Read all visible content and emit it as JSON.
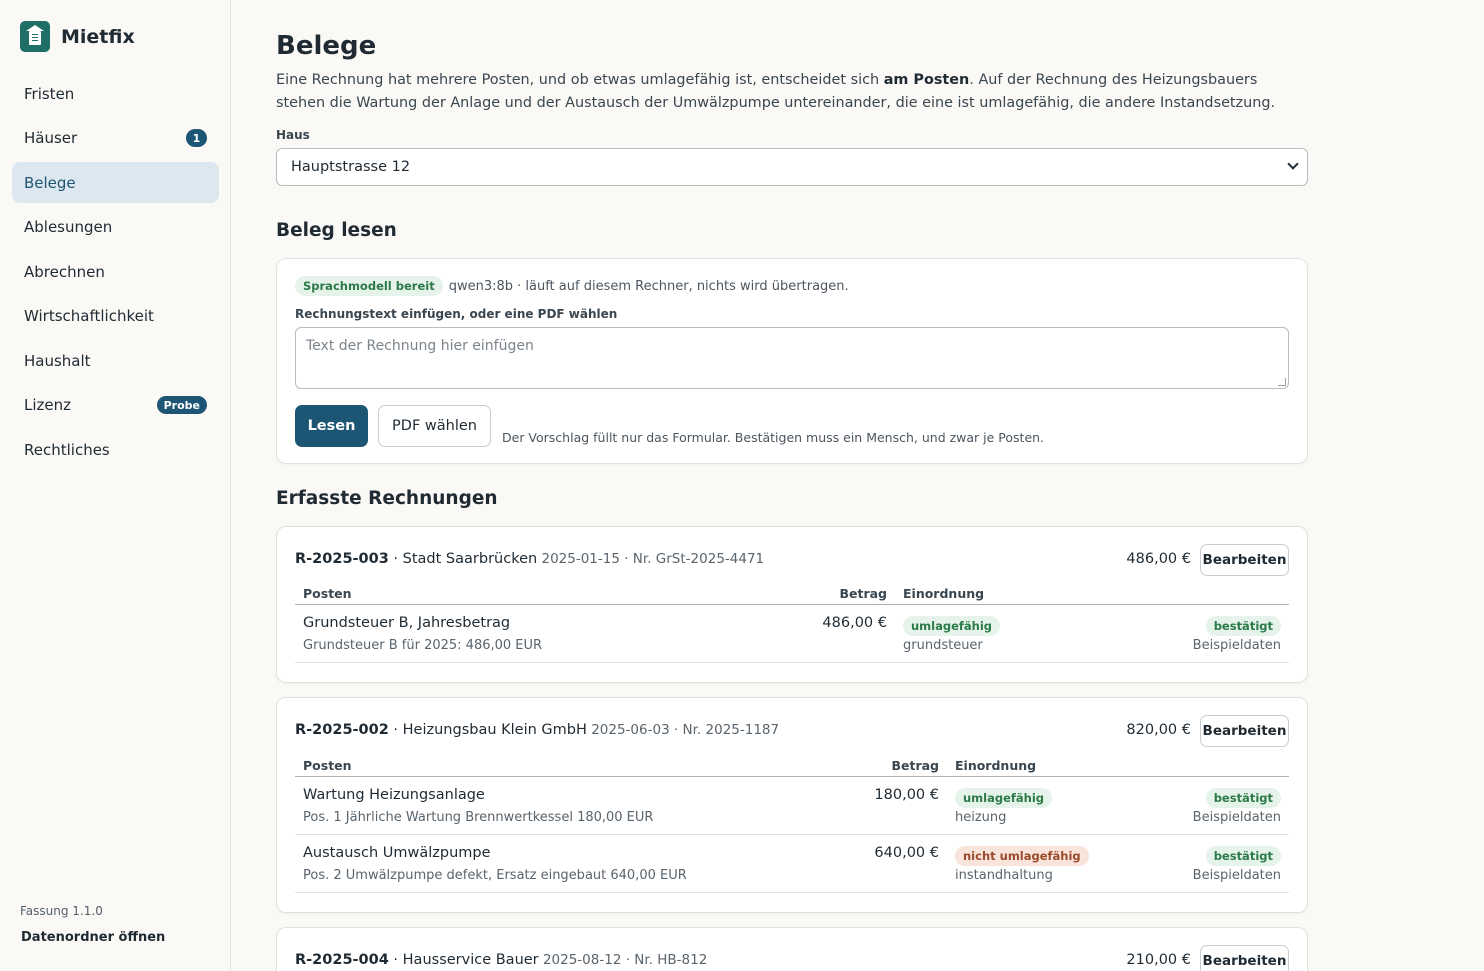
{
  "app": {
    "name": "Mietfix",
    "version": "Fassung 1.1.0",
    "open_folder": "Datenordner öffnen",
    "brand_color": "#1f6f66",
    "accent": "#1d5674"
  },
  "sidebar": {
    "items": [
      {
        "label": "Fristen"
      },
      {
        "label": "Häuser",
        "badge": "1"
      },
      {
        "label": "Belege",
        "active": true
      },
      {
        "label": "Ablesungen"
      },
      {
        "label": "Abrechnen"
      },
      {
        "label": "Wirtschaftlichkeit"
      },
      {
        "label": "Haushalt"
      },
      {
        "label": "Lizenz",
        "badge": "Probe"
      },
      {
        "label": "Rechtliches"
      }
    ]
  },
  "page": {
    "title": "Belege",
    "intro_1": "Eine Rechnung hat mehrere Posten, und ob etwas umlagefähig ist, entscheidet sich ",
    "intro_bold": "am Posten",
    "intro_2": ". Auf der Rechnung des Heizungsbauers stehen die Wartung der Anlage und der Austausch der Umwälzpumpe untereinander, die eine ist umlagefähig, die andere Instandsetzung.",
    "haus_label": "Haus",
    "haus_value": "Hauptstrasse 12"
  },
  "reader": {
    "heading": "Beleg lesen",
    "model_status": "Sprachmodell bereit",
    "model_info": "qwen3:8b · läuft auf diesem Rechner, nichts wird übertragen.",
    "text_label": "Rechnungstext einfügen, oder eine PDF wählen",
    "placeholder": "Text der Rechnung hier einfügen",
    "read_button": "Lesen",
    "pdf_button": "PDF wählen",
    "hint": "Der Vorschlag füllt nur das Formular. Bestätigen muss ein Mensch, und zwar je Posten."
  },
  "invoices_heading": "Erfasste Rechnungen",
  "table_headers": {
    "posten": "Posten",
    "betrag": "Betrag",
    "einordnung": "Einordnung"
  },
  "edit_label": "Bearbeiten",
  "invoices": [
    {
      "number": "R-2025-003",
      "vendor": " · Stadt Saarbrücken",
      "meta": " 2025-01-15 · Nr. GrSt-2025-4471",
      "total": "486,00 €",
      "items": [
        {
          "title": "Grundsteuer B, Jahresbetrag",
          "sub": "Grundsteuer B für 2025: 486,00 EUR",
          "amount": "486,00 €",
          "category": "umlagefähig",
          "category_sub": "grundsteuer",
          "status": "bestätigt",
          "source": "Beispieldaten"
        }
      ]
    },
    {
      "number": "R-2025-002",
      "vendor": " · Heizungsbau Klein GmbH",
      "meta": " 2025-06-03 · Nr. 2025-1187",
      "total": "820,00 €",
      "items": [
        {
          "title": "Wartung Heizungsanlage",
          "sub": "Pos. 1 Jährliche Wartung Brennwertkessel 180,00 EUR",
          "amount": "180,00 €",
          "category": "umlagefähig",
          "category_sub": "heizung",
          "status": "bestätigt",
          "source": "Beispieldaten"
        },
        {
          "title": "Austausch Umwälzpumpe",
          "sub": "Pos. 2 Umwälzpumpe defekt, Ersatz eingebaut 640,00 EUR",
          "amount": "640,00 €",
          "category": "nicht umlagefähig",
          "category_sub": "instandhaltung",
          "status": "bestätigt",
          "source": "Beispieldaten"
        }
      ]
    },
    {
      "number": "R-2025-004",
      "vendor": " · Hausservice Bauer",
      "meta": " 2025-08-12 · Nr. HB-812",
      "total": "210,00 €"
    }
  ]
}
